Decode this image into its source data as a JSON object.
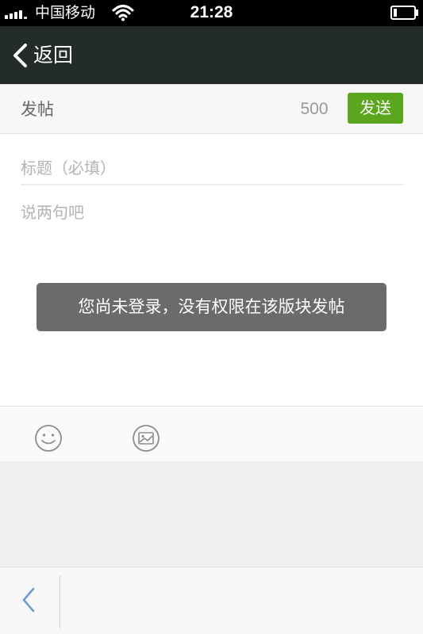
{
  "status_bar": {
    "carrier": "中国移动",
    "time": "21:28",
    "icons": [
      "signal-icon",
      "wifi-icon",
      "battery-icon"
    ]
  },
  "nav": {
    "back_label": "返回",
    "back_icon": "chevron-left-icon"
  },
  "post_header": {
    "title": "发帖",
    "char_count": "500",
    "send_label": "发送"
  },
  "compose": {
    "title_placeholder": "标题（必填）",
    "title_value": "",
    "body_placeholder": "说两句吧",
    "body_value": ""
  },
  "toast": {
    "message": "您尚未登录，没有权限在该版块发帖"
  },
  "toolbar": {
    "icons": [
      "emoji-icon",
      "image-icon"
    ]
  },
  "bottom_bar": {
    "icons": [
      "back-arrow-icon"
    ]
  },
  "colors": {
    "status_bar_bg": "#000000",
    "nav_bg": "#232b2b",
    "send_button": "#5aa61f",
    "toast_bg": "#6b6b6b",
    "panel_bg": "#efefef",
    "back_arrow": "#6b9bd1"
  }
}
